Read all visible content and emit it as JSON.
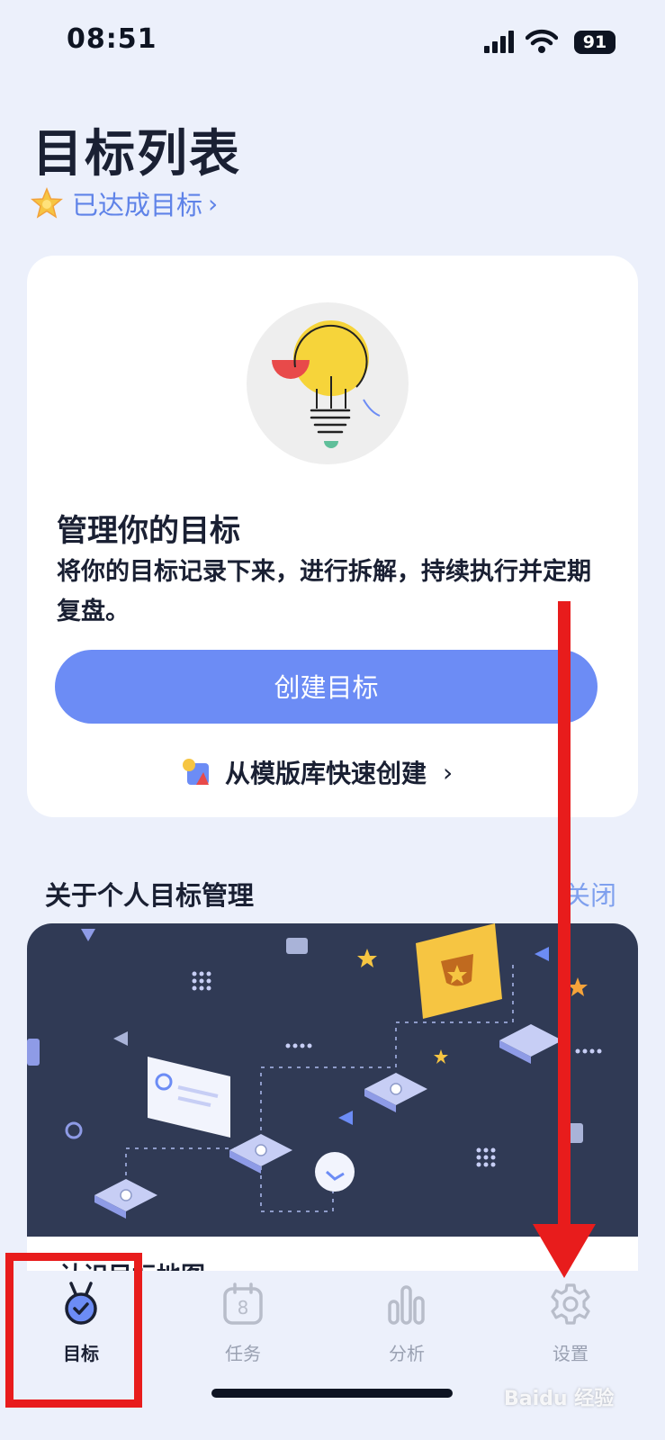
{
  "status_bar": {
    "time": "08:51",
    "battery": "91"
  },
  "header": {
    "title": "目标列表",
    "achieved_label": "已达成目标",
    "achieved_chevron": "›"
  },
  "card": {
    "title": "管理你的目标",
    "description": "将你的目标记录下来，进行拆解，持续执行并定期复盘。",
    "create_button": "创建目标",
    "template_link": "从模版库快速创建",
    "template_chevron": "›"
  },
  "about": {
    "title": "关于个人目标管理",
    "close": "关闭",
    "caption": "认识目标地图"
  },
  "tabbar": {
    "tabs": [
      {
        "label": "目标",
        "icon": "medal-check-icon",
        "active": true
      },
      {
        "label": "任务",
        "icon": "calendar-8-icon",
        "active": false
      },
      {
        "label": "分析",
        "icon": "bar-chart-icon",
        "active": false
      },
      {
        "label": "设置",
        "icon": "gear-icon",
        "active": false
      }
    ],
    "calendar_day": "8"
  },
  "watermark": "Baidu 经验",
  "colors": {
    "accent": "#6C8CF5",
    "link": "#5F83E8",
    "annotation": "#E81C1C",
    "illustration_bg": "#303A55"
  }
}
